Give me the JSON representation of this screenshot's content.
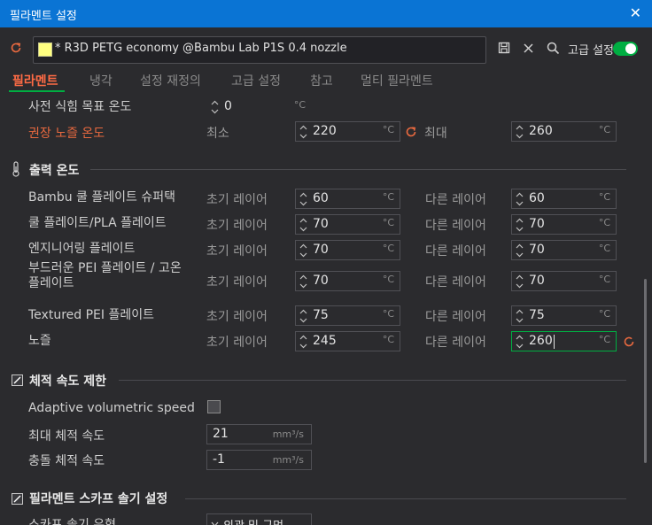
{
  "window": {
    "title": "필라멘트 설정",
    "close_glyph": "✕"
  },
  "preset": {
    "name": "* R3D PETG economy @Bambu Lab P1S 0.4 nozzle",
    "swatch_color": "#ffff80",
    "advanced_label": "고급 설정",
    "advanced_on": true,
    "accent_color": "#00ae42",
    "icons": [
      "reset-icon",
      "save-icon",
      "delete-icon",
      "search-icon"
    ]
  },
  "tabs": [
    {
      "label": "필라멘트",
      "active": true
    },
    {
      "label": "냉각",
      "active": false
    },
    {
      "label": "설정 재정의",
      "active": false
    },
    {
      "label": "고급 설정",
      "active": false
    },
    {
      "label": "참고",
      "active": false
    },
    {
      "label": "멀티 필라멘트",
      "active": false
    }
  ],
  "preheat": {
    "label": "사전 식힘 목표 온도",
    "value": "0",
    "unit": "°C"
  },
  "recommended": {
    "label": "권장 노즐 온도",
    "min_label": "최소",
    "min_value": "220",
    "max_label": "최대",
    "max_value": "260",
    "unit": "°C"
  },
  "print_temp": {
    "title": "출력 온도",
    "first_label": "초기 레이어",
    "other_label": "다른 레이어",
    "unit": "°C",
    "rows": [
      {
        "label": "Bambu 쿨 플레이트 슈퍼택",
        "first": "60",
        "other": "60"
      },
      {
        "label": "쿨 플레이트/PLA 플레이트",
        "first": "70",
        "other": "70"
      },
      {
        "label": "엔지니어링 플레이트",
        "first": "70",
        "other": "70"
      },
      {
        "label": "부드러운 PEI 플레이트 / 고온 플레이트",
        "first": "70",
        "other": "70"
      },
      {
        "label": "Textured PEI 플레이트",
        "first": "75",
        "other": "75"
      },
      {
        "label": "노즐",
        "first": "245",
        "other": "260"
      }
    ]
  },
  "volumetric": {
    "title": "체적 속도 제한",
    "adaptive_label": "Adaptive volumetric speed",
    "adaptive_checked": false,
    "max_label": "최대 체적 속도",
    "max_value": "21",
    "ramming_label": "충돌 체적 속도",
    "ramming_value": "-1",
    "unit": "mm³/s"
  },
  "scarf": {
    "title": "필라멘트 스카프 솔기 설정",
    "type_label": "스카프 솔기 유형",
    "type_value": "외곽 및 구멍"
  }
}
